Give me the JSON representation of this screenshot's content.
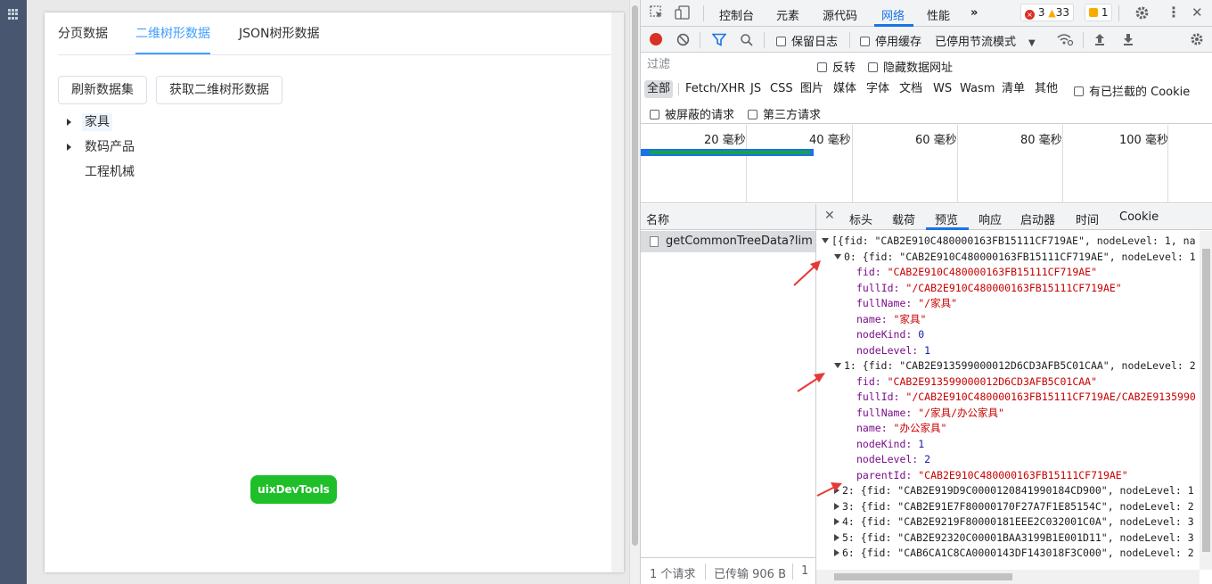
{
  "app": {
    "tabs": [
      {
        "label": "分页数据"
      },
      {
        "label": "二维树形数据"
      },
      {
        "label": "JSON树形数据"
      }
    ],
    "buttons": {
      "refresh": "刷新数据集",
      "fetch": "获取二维树形数据"
    },
    "tree": [
      {
        "label": "家具",
        "expandable": true
      },
      {
        "label": "数码产品",
        "expandable": true
      },
      {
        "label": "工程机械",
        "expandable": false
      }
    ],
    "floating_button": "uixDevTools"
  },
  "devtools": {
    "main_tabs": [
      "控制台",
      "元素",
      "源代码",
      "网络",
      "性能"
    ],
    "active_main_tab": "网络",
    "badges": {
      "errors": "3",
      "warnings": "33",
      "info": "1"
    },
    "toolbar": {
      "preserve_log": "保留日志",
      "disable_cache": "停用缓存",
      "throttle": "已停用节流模式"
    },
    "filter": {
      "placeholder": "过滤",
      "invert": "反转",
      "hide_data_urls": "隐藏数据网址"
    },
    "types": [
      "全部",
      "Fetch/XHR",
      "JS",
      "CSS",
      "图片",
      "媒体",
      "字体",
      "文档",
      "WS",
      "Wasm",
      "清单",
      "其他"
    ],
    "blocked_cookies": "有已拦截的 Cookie",
    "blocked_requests": "被屏蔽的请求",
    "third_party": "第三方请求",
    "timeline_labels": [
      "20 毫秒",
      "40 毫秒",
      "60 毫秒",
      "80 毫秒",
      "100 毫秒"
    ],
    "name_header": "名称",
    "request_name": "getCommonTreeData?limi...",
    "panel_tabs": [
      "标头",
      "载荷",
      "预览",
      "响应",
      "启动器",
      "时间",
      "Cookie"
    ],
    "active_panel_tab": "预览",
    "status": {
      "requests": "1 个请求",
      "transferred": "已传输 906 B",
      "extra": "1"
    },
    "preview": {
      "root": "[{fid: \"CAB2E910C480000163FB15111CF719AE\", nodeLevel: 1, na",
      "item0_head": "0: {fid: \"CAB2E910C480000163FB15111CF719AE\", nodeLevel: 1",
      "item0": [
        {
          "key": "fid",
          "value": "\"CAB2E910C480000163FB15111CF719AE\"",
          "kind": "s"
        },
        {
          "key": "fullId",
          "value": "\"/CAB2E910C480000163FB15111CF719AE\"",
          "kind": "s"
        },
        {
          "key": "fullName",
          "value": "\"/家具\"",
          "kind": "s"
        },
        {
          "key": "name",
          "value": "\"家具\"",
          "kind": "s"
        },
        {
          "key": "nodeKind",
          "value": "0",
          "kind": "n"
        },
        {
          "key": "nodeLevel",
          "value": "1",
          "kind": "n"
        }
      ],
      "item1_head": "1: {fid: \"CAB2E913599000012D6CD3AFB5C01CAA\", nodeLevel: 2",
      "item1": [
        {
          "key": "fid",
          "value": "\"CAB2E913599000012D6CD3AFB5C01CAA\"",
          "kind": "s"
        },
        {
          "key": "fullId",
          "value": "\"/CAB2E910C480000163FB15111CF719AE/CAB2E9135990",
          "kind": "s"
        },
        {
          "key": "fullName",
          "value": "\"/家具/办公家具\"",
          "kind": "s"
        },
        {
          "key": "name",
          "value": "\"办公家具\"",
          "kind": "s"
        },
        {
          "key": "nodeKind",
          "value": "1",
          "kind": "n"
        },
        {
          "key": "nodeLevel",
          "value": "2",
          "kind": "n"
        },
        {
          "key": "parentId",
          "value": "\"CAB2E910C480000163FB15111CF719AE\"",
          "kind": "s"
        }
      ],
      "collapsed": [
        "2: {fid: \"CAB2E919D9C0000120841990184CD900\", nodeLevel: 1",
        "3: {fid: \"CAB2E91E7F80000170F27A7F1E85154C\", nodeLevel: 2",
        "4: {fid: \"CAB2E9219F80000181EEE2C032001C0A\", nodeLevel: 3",
        "5: {fid: \"CAB2E92320C00001BAA3199B1E001D11\", nodeLevel: 3",
        "6: {fid: \"CAB6CA1C8CA0000143DF143018F3C000\", nodeLevel: 2"
      ]
    },
    "accent": "#1a73e8"
  }
}
